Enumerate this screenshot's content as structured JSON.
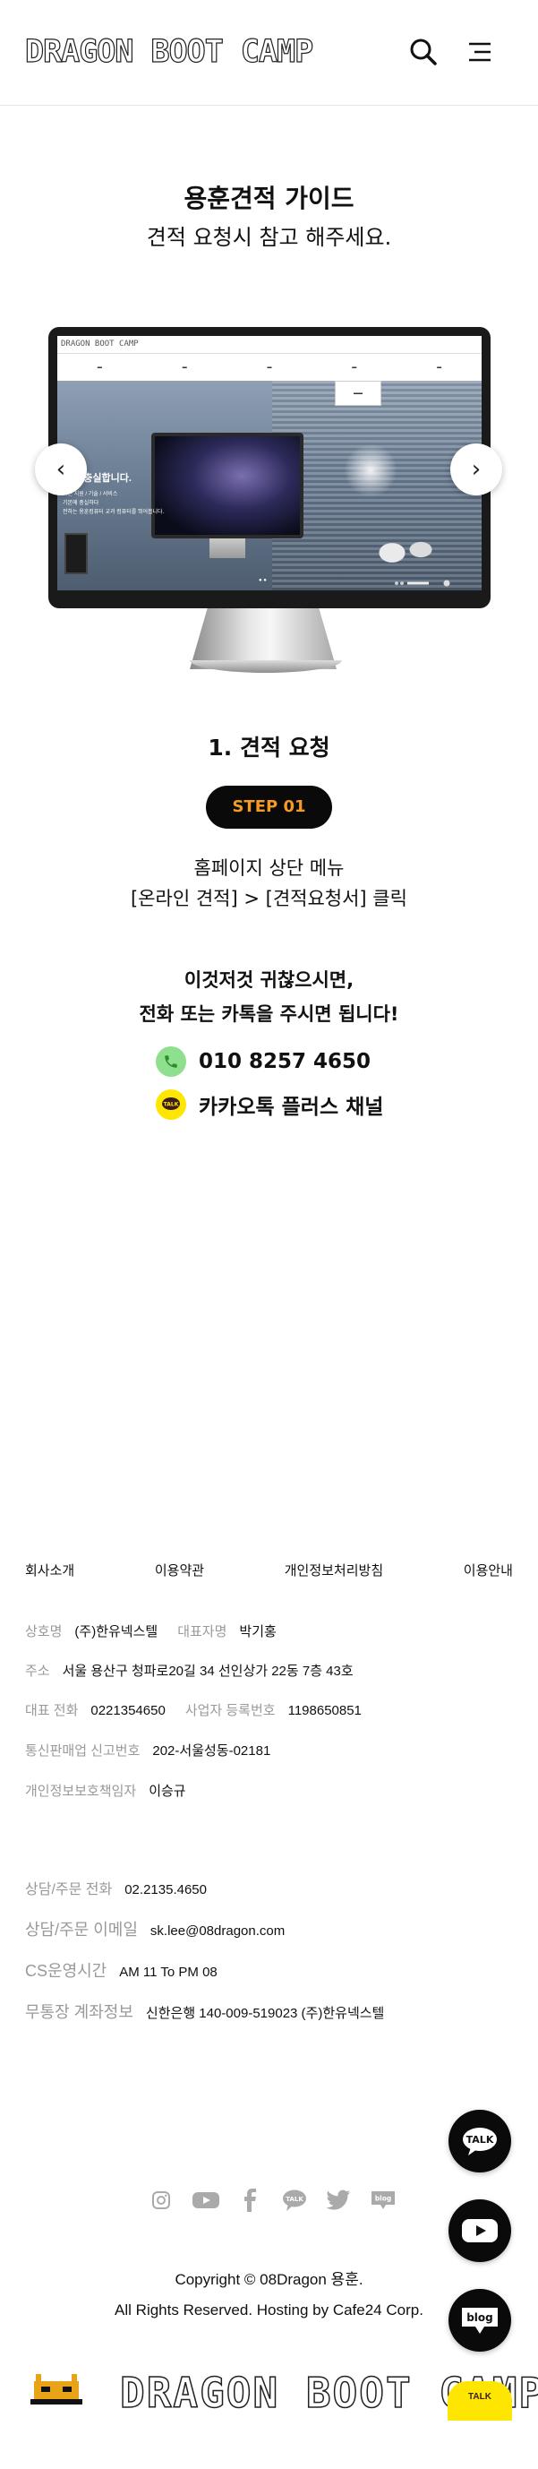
{
  "header": {
    "logo_text": "DRAGON BOOT CAMP",
    "search_icon": "search-icon",
    "menu_icon": "menu-icon"
  },
  "guide": {
    "title": "용훈견적 가이드",
    "subtitle": "견적 요청시 참고 해주세요."
  },
  "slider": {
    "prev_label": "‹",
    "next_label": "›",
    "screen": {
      "site_logo": "DRAGON BOOT CAMP",
      "hero_text": "본에 충실합니다.",
      "hero_sub_1": "라인 지원 / 기술 / 서비스",
      "hero_sub_2": "기본에 충실하다",
      "hero_sub_3": "전하는 용훈컴퓨터 교과 컴퓨터를 뛰어봅니다.",
      "dots": "● ●"
    }
  },
  "step": {
    "title": "1. 견적 요청",
    "badge": "STEP 01",
    "desc_line1": "홈페이지 상단 메뉴",
    "desc_line2": "[온라인 견적] > [견적요청서] 클릭"
  },
  "contact": {
    "intro_line1": "이것저것 귀찮으시면,",
    "intro_line2": "전화 또는 카톡을 주시면 됩니다!",
    "phone": "010 8257 4650",
    "kakao": "카카오톡 플러스 채널",
    "kakao_icon_text": "TALK"
  },
  "footer": {
    "links": [
      "회사소개",
      "이용약관",
      "개인정보처리방침",
      "이용안내"
    ],
    "company_label": "상호명",
    "company_value": "(주)한유넥스텔",
    "ceo_label": "대표자명",
    "ceo_value": "박기홍",
    "address_label": "주소",
    "address_value": "서울 용산구 청파로20길 34 선인상가 22동 7층 43호",
    "tel_label": "대표 전화",
    "tel_value": "0221354650",
    "bizno_label": "사업자 등록번호",
    "bizno_value": "1198650851",
    "mailorder_label": "통신판매업 신고번호",
    "mailorder_value": "202-서울성동-02181",
    "privacy_label": "개인정보보호책임자",
    "privacy_value": "이승규",
    "cs_phone_label": "상담/주문 전화",
    "cs_phone_value": "02.2135.4650",
    "cs_email_label": "상담/주문 이메일",
    "cs_email_value": "sk.lee@08dragon.com",
    "cs_hours_label": "CS운영시간",
    "cs_hours_value": "AM 11 To PM 08",
    "bank_label": "무통장 계좌정보",
    "bank_value": "신한은행 140-009-519023 (주)한유넥스텔",
    "social_icons": [
      "instagram-icon",
      "youtube-icon",
      "facebook-icon",
      "kakaotalk-icon",
      "twitter-icon",
      "blog-icon"
    ],
    "social_talk_text": "TALK",
    "social_blog_text": "blog",
    "copyright_line1": "Copyright © 08Dragon 용훈.",
    "copyright_line2": "All Rights Reserved. Hosting by Cafe24 Corp."
  },
  "floating": {
    "talk_label": "TALK",
    "blog_label": "blog"
  },
  "bottom": {
    "logo_text": "DRAGON BOOT CAMP",
    "talk_label": "TALK"
  },
  "colors": {
    "accent_orange": "#f59a23",
    "badge_bg": "#0a0a0a",
    "kakao_yellow": "#ffe600",
    "phone_green": "#8ee08e",
    "muted_label": "#999999"
  }
}
